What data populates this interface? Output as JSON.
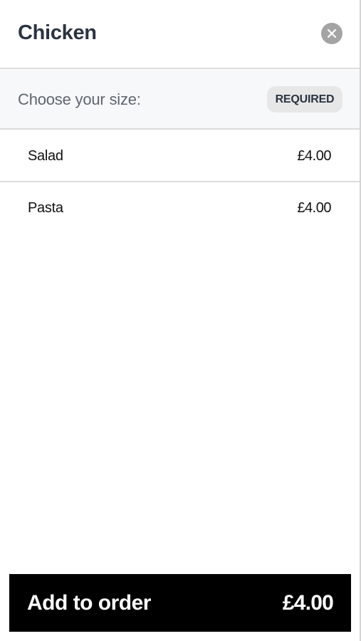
{
  "item": {
    "title": "Chicken",
    "close_icon": "close-icon"
  },
  "option_group": {
    "label": "Choose your size:",
    "badge": "REQUIRED",
    "options": [
      {
        "name": "Salad",
        "price": "£4.00"
      },
      {
        "name": "Pasta",
        "price": "£4.00"
      }
    ]
  },
  "cta": {
    "label": "Add to order",
    "price": "£4.00"
  },
  "colors": {
    "title": "#2a3342",
    "close_bg": "#a4a4a4",
    "group_bg": "#f7f8fa",
    "badge_bg": "#e7e7e7",
    "cta_bg": "#000000",
    "cta_text": "#ffffff"
  }
}
